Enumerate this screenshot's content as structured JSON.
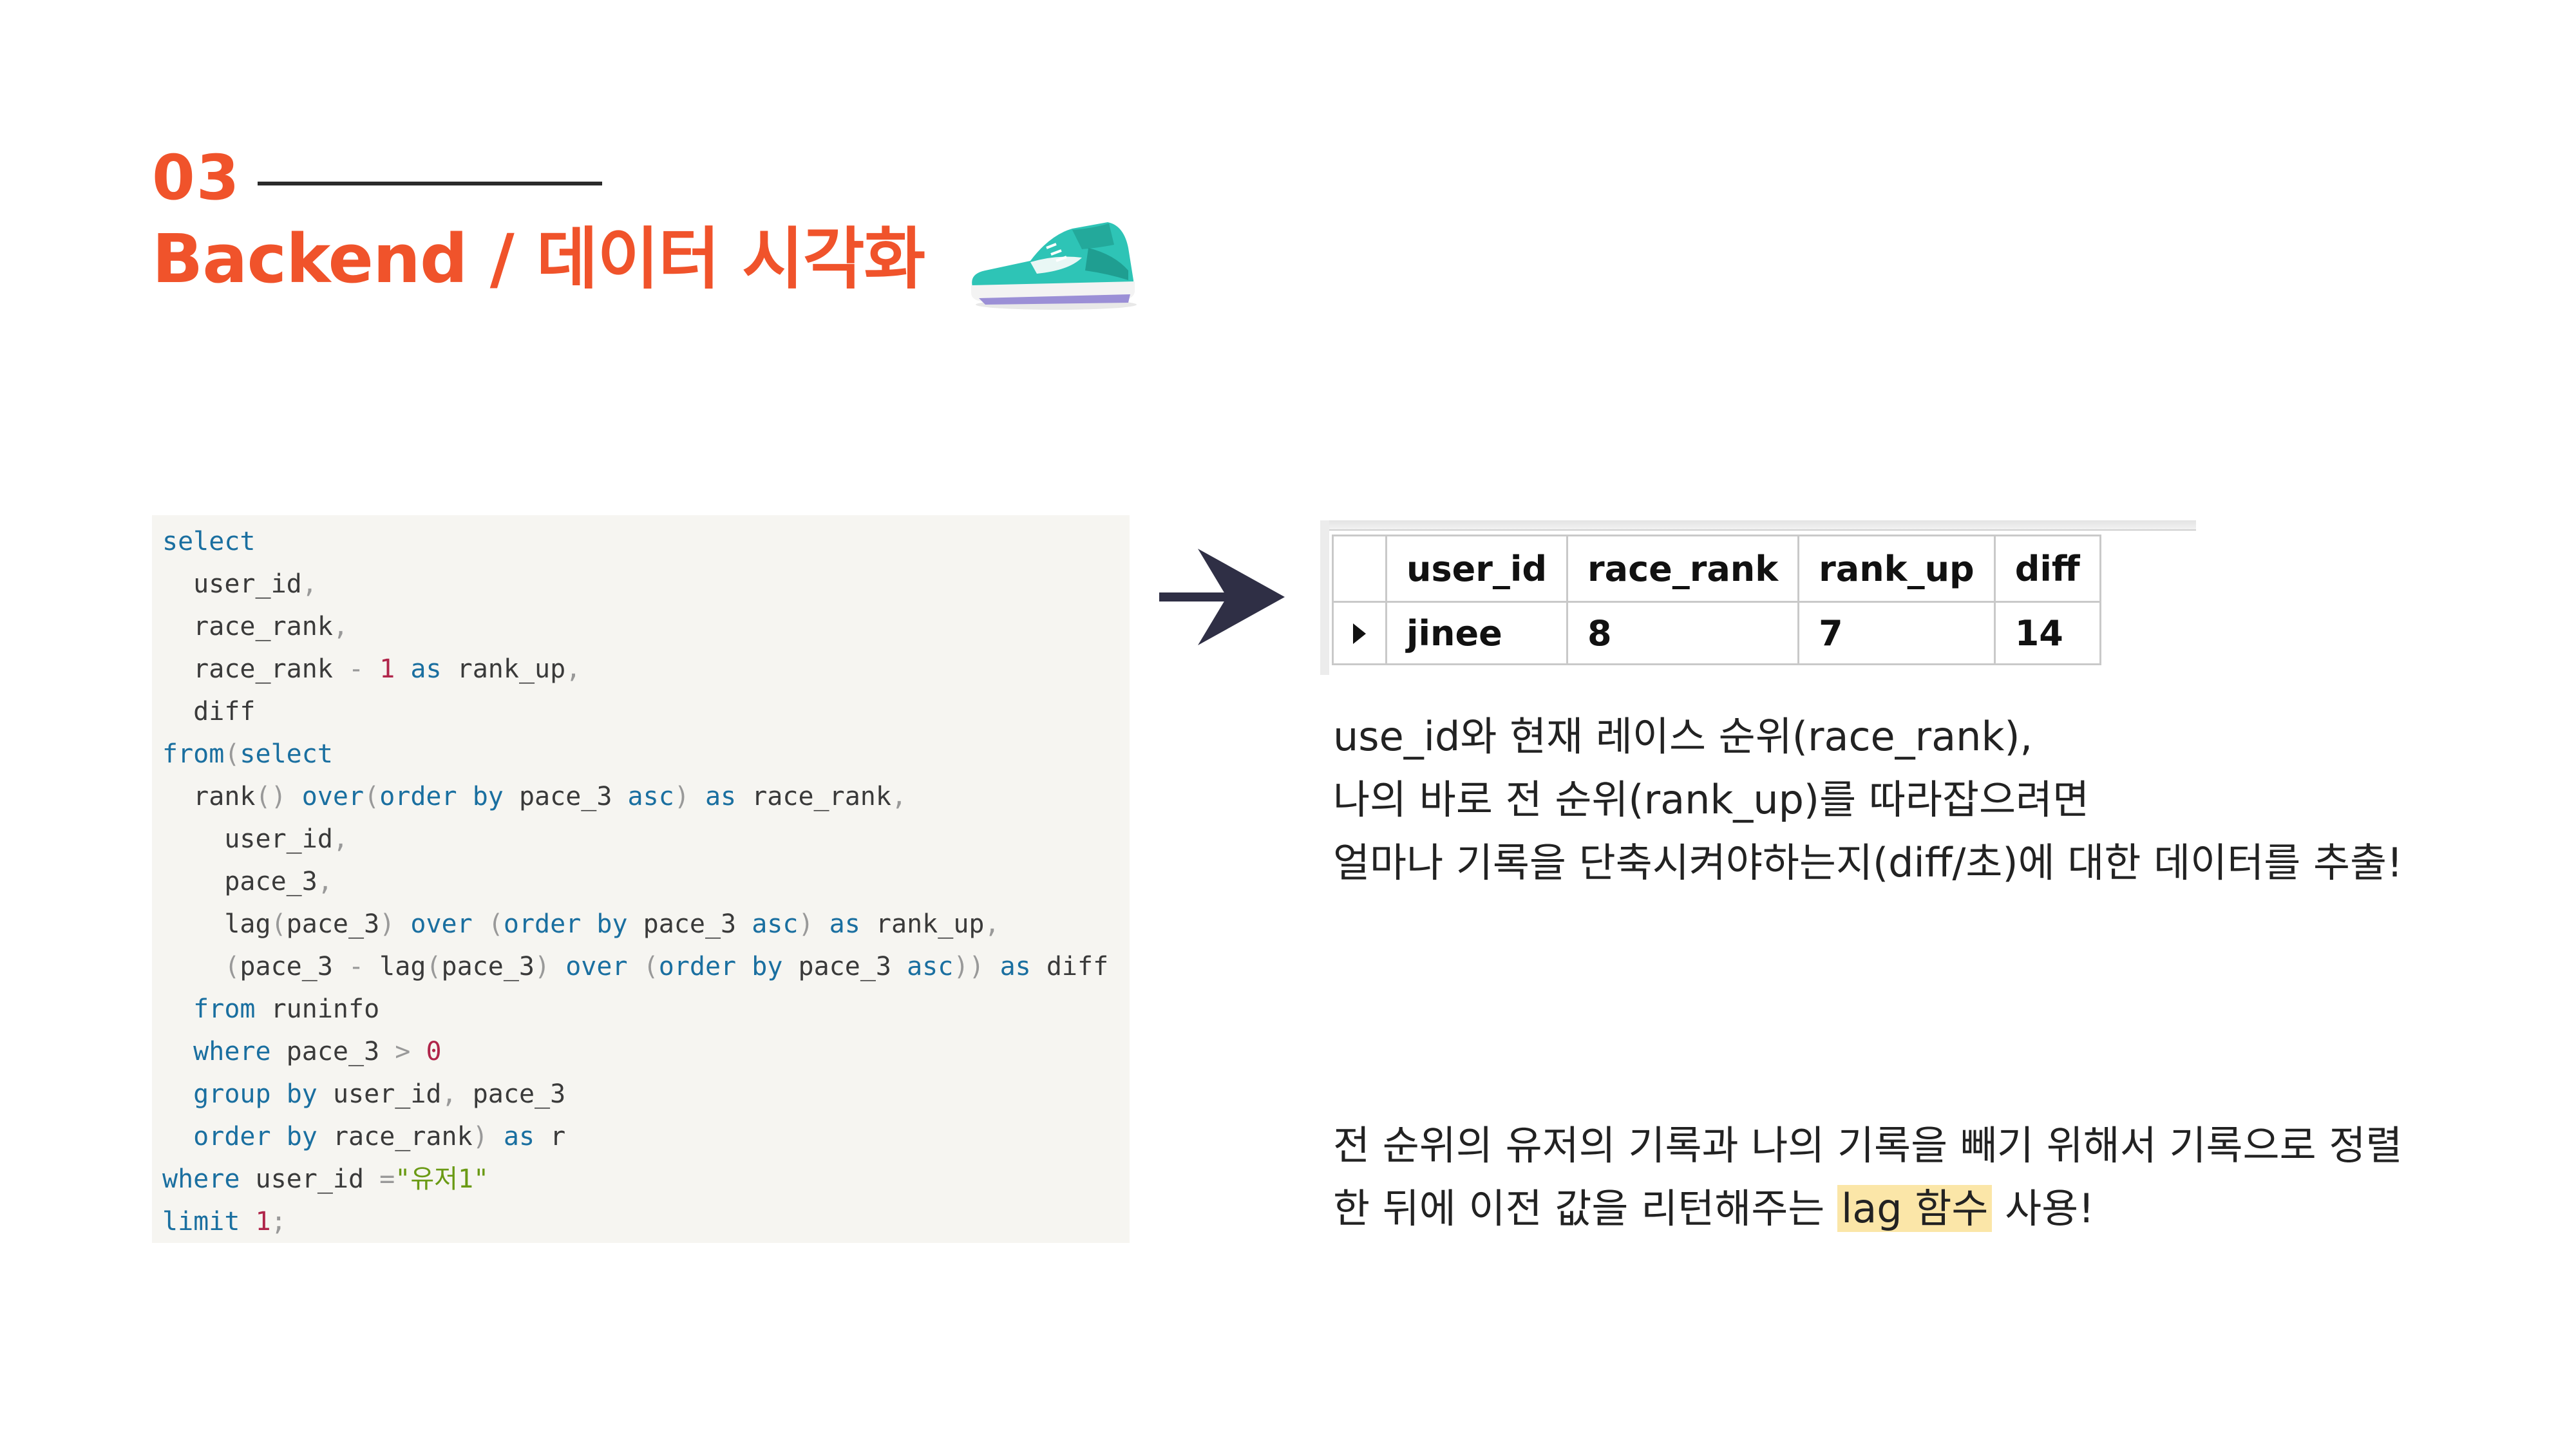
{
  "header": {
    "section_number": "03",
    "title": "Backend / 데이터 시각화"
  },
  "code": {
    "lines": [
      [
        {
          "t": "select",
          "c": "kw"
        }
      ],
      [
        {
          "t": "  user_id"
        },
        {
          "t": ",",
          "c": "pu"
        }
      ],
      [
        {
          "t": "  race_rank"
        },
        {
          "t": ",",
          "c": "pu"
        }
      ],
      [
        {
          "t": "  race_rank "
        },
        {
          "t": "-",
          "c": "pu"
        },
        {
          "t": " "
        },
        {
          "t": "1",
          "c": "num"
        },
        {
          "t": " "
        },
        {
          "t": "as",
          "c": "kw"
        },
        {
          "t": " rank_up"
        },
        {
          "t": ",",
          "c": "pu"
        }
      ],
      [
        {
          "t": "  diff"
        }
      ],
      [
        {
          "t": "from",
          "c": "kw"
        },
        {
          "t": "(",
          "c": "pu"
        },
        {
          "t": "select",
          "c": "kw"
        }
      ],
      [
        {
          "t": "  rank"
        },
        {
          "t": "()",
          "c": "pu"
        },
        {
          "t": " "
        },
        {
          "t": "over",
          "c": "kw"
        },
        {
          "t": "(",
          "c": "pu"
        },
        {
          "t": "order",
          "c": "kw"
        },
        {
          "t": " "
        },
        {
          "t": "by",
          "c": "kw"
        },
        {
          "t": " pace_3 "
        },
        {
          "t": "asc",
          "c": "kw"
        },
        {
          "t": ")",
          "c": "pu"
        },
        {
          "t": " "
        },
        {
          "t": "as",
          "c": "kw"
        },
        {
          "t": " race_rank"
        },
        {
          "t": ",",
          "c": "pu"
        }
      ],
      [
        {
          "t": "    user_id"
        },
        {
          "t": ",",
          "c": "pu"
        }
      ],
      [
        {
          "t": "    pace_3"
        },
        {
          "t": ",",
          "c": "pu"
        }
      ],
      [
        {
          "t": "    lag"
        },
        {
          "t": "(",
          "c": "pu"
        },
        {
          "t": "pace_3"
        },
        {
          "t": ")",
          "c": "pu"
        },
        {
          "t": " "
        },
        {
          "t": "over",
          "c": "kw"
        },
        {
          "t": " "
        },
        {
          "t": "(",
          "c": "pu"
        },
        {
          "t": "order",
          "c": "kw"
        },
        {
          "t": " "
        },
        {
          "t": "by",
          "c": "kw"
        },
        {
          "t": " pace_3 "
        },
        {
          "t": "asc",
          "c": "kw"
        },
        {
          "t": ")",
          "c": "pu"
        },
        {
          "t": " "
        },
        {
          "t": "as",
          "c": "kw"
        },
        {
          "t": " rank_up"
        },
        {
          "t": ",",
          "c": "pu"
        }
      ],
      [
        {
          "t": "    "
        },
        {
          "t": "(",
          "c": "pu"
        },
        {
          "t": "pace_3 "
        },
        {
          "t": "-",
          "c": "pu"
        },
        {
          "t": " lag"
        },
        {
          "t": "(",
          "c": "pu"
        },
        {
          "t": "pace_3"
        },
        {
          "t": ")",
          "c": "pu"
        },
        {
          "t": " "
        },
        {
          "t": "over",
          "c": "kw"
        },
        {
          "t": " "
        },
        {
          "t": "(",
          "c": "pu"
        },
        {
          "t": "order",
          "c": "kw"
        },
        {
          "t": " "
        },
        {
          "t": "by",
          "c": "kw"
        },
        {
          "t": " pace_3 "
        },
        {
          "t": "asc",
          "c": "kw"
        },
        {
          "t": "))",
          "c": "pu"
        },
        {
          "t": " "
        },
        {
          "t": "as",
          "c": "kw"
        },
        {
          "t": " diff"
        }
      ],
      [
        {
          "t": "  "
        },
        {
          "t": "from",
          "c": "kw"
        },
        {
          "t": " runinfo"
        }
      ],
      [
        {
          "t": "  "
        },
        {
          "t": "where",
          "c": "kw"
        },
        {
          "t": " pace_3 "
        },
        {
          "t": ">",
          "c": "pu"
        },
        {
          "t": " "
        },
        {
          "t": "0",
          "c": "num"
        }
      ],
      [
        {
          "t": "  "
        },
        {
          "t": "group",
          "c": "kw"
        },
        {
          "t": " "
        },
        {
          "t": "by",
          "c": "kw"
        },
        {
          "t": " user_id"
        },
        {
          "t": ",",
          "c": "pu"
        },
        {
          "t": " pace_3"
        }
      ],
      [
        {
          "t": "  "
        },
        {
          "t": "order",
          "c": "kw"
        },
        {
          "t": " "
        },
        {
          "t": "by",
          "c": "kw"
        },
        {
          "t": " race_rank"
        },
        {
          "t": ")",
          "c": "pu"
        },
        {
          "t": " "
        },
        {
          "t": "as",
          "c": "kw"
        },
        {
          "t": " r"
        }
      ],
      [
        {
          "t": "where",
          "c": "kw"
        },
        {
          "t": " user_id "
        },
        {
          "t": "=",
          "c": "pu"
        },
        {
          "t": "\"유저1\"",
          "c": "str"
        }
      ],
      [
        {
          "t": "limit",
          "c": "kw"
        },
        {
          "t": " "
        },
        {
          "t": "1",
          "c": "num"
        },
        {
          "t": ";",
          "c": "pu"
        }
      ]
    ]
  },
  "result": {
    "columns": [
      "user_id",
      "race_rank",
      "rank_up",
      "diff"
    ],
    "rows": [
      [
        "jinee",
        "8",
        "7",
        "14"
      ]
    ]
  },
  "description": {
    "line1": "use_id와 현재 레이스 순위(race_rank),",
    "line2": "나의 바로 전 순위(rank_up)를 따라잡으려면",
    "line3": "얼마나 기록을 단축시켜야하는지(diff/초)에 대한 데이터를 추출!",
    "line4": "전 순위의 유저의 기록과 나의 기록을 빼기 위해서 기록으로 정렬",
    "line5_before": "한 뒤에 이전 값을 리턴해주는 ",
    "line5_highlight": "lag 함수",
    "line5_after": " 사용!"
  },
  "colors": {
    "accent": "#f0532b",
    "highlight": "#fbe6a8",
    "code_bg": "#f6f5f1"
  },
  "icons": [
    "sneaker-icon",
    "right-arrow-icon",
    "row-pointer-icon"
  ]
}
